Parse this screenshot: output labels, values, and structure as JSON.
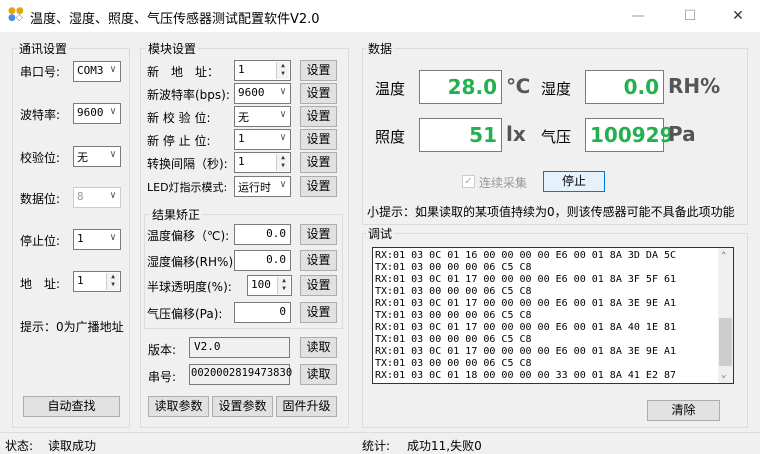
{
  "window": {
    "title": "温度、湿度、照度、气压传感器测试配置软件V2.0",
    "minimize": "—",
    "maximize": "☐",
    "close": "✕"
  },
  "comm": {
    "title": "通讯设置",
    "port_label": "串口号:",
    "port": "COM3",
    "baud_label": "波特率:",
    "baud": "9600",
    "parity_label": "校验位:",
    "parity": "无",
    "databits_label": "数据位:",
    "databits": "8",
    "stopbits_label": "停止位:",
    "stopbits": "1",
    "addr_label": "地　址:",
    "addr": "1",
    "hint": "提示：0为广播地址",
    "auto_find": "自动查找"
  },
  "module": {
    "title": "模块设置",
    "rows": [
      {
        "label": "新　地　址：",
        "value": "1"
      },
      {
        "label": "新波特率(bps):",
        "value": "9600"
      },
      {
        "label": "新 校 验 位:",
        "value": "无"
      },
      {
        "label": "新 停 止 位:",
        "value": "1"
      },
      {
        "label": "转换间隔（秒):",
        "value": "1"
      },
      {
        "label": "LED灯指示模式:",
        "value": "运行时"
      }
    ],
    "set": "设置",
    "calib": {
      "title": "结果矫正",
      "rows": [
        {
          "label": "温度偏移（℃):",
          "value": "0.0"
        },
        {
          "label": "湿度偏移(RH%):",
          "value": "0.0"
        },
        {
          "label": "半球透明度(%):",
          "value": "100"
        },
        {
          "label": "气压偏移(Pa):",
          "value": "0"
        }
      ]
    },
    "version_label": "版本:",
    "version": "V2.0",
    "serial_label": "串号:",
    "serial": "0020002819473830",
    "read": "读取",
    "read_params": "读取参数",
    "set_params": "设置参数",
    "firmware": "固件升级"
  },
  "data": {
    "title": "数据",
    "temp_label": "温度",
    "temp": "28.0",
    "temp_unit": "℃",
    "hum_label": "湿度",
    "hum": "0.0",
    "hum_unit": "RH%",
    "lux_label": "照度",
    "lux": "51",
    "lux_unit": "lx",
    "press_label": "气压",
    "press": "100929",
    "press_unit": "Pa",
    "continuous": "连续采集",
    "stop": "停止",
    "tip": "小提示：如果读取的某项值持续为0，则该传感器可能不具备此项功能"
  },
  "debug": {
    "title": "调试",
    "log": "RX:01 03 0C 01 16 00 00 00 00 E6 00 01 8A 3D DA 5C\nTX:01 03 00 00 00 06 C5 C8\nRX:01 03 0C 01 17 00 00 00 00 E6 00 01 8A 3F 5F 61\nTX:01 03 00 00 00 06 C5 C8\nRX:01 03 0C 01 17 00 00 00 00 E6 00 01 8A 3E 9E A1\nTX:01 03 00 00 00 06 C5 C8\nRX:01 03 0C 01 17 00 00 00 00 E6 00 01 8A 40 1E 81\nTX:01 03 00 00 00 06 C5 C8\nRX:01 03 0C 01 17 00 00 00 00 E6 00 01 8A 3E 9E A1\nTX:01 03 00 00 00 06 C5 C8\nRX:01 03 0C 01 18 00 00 00 00 33 00 01 8A 41 E2 87",
    "clear": "清除"
  },
  "status": {
    "label": "状态:",
    "value": "读取成功",
    "stats_label": "统计:",
    "stats": "成功11,失败0"
  }
}
